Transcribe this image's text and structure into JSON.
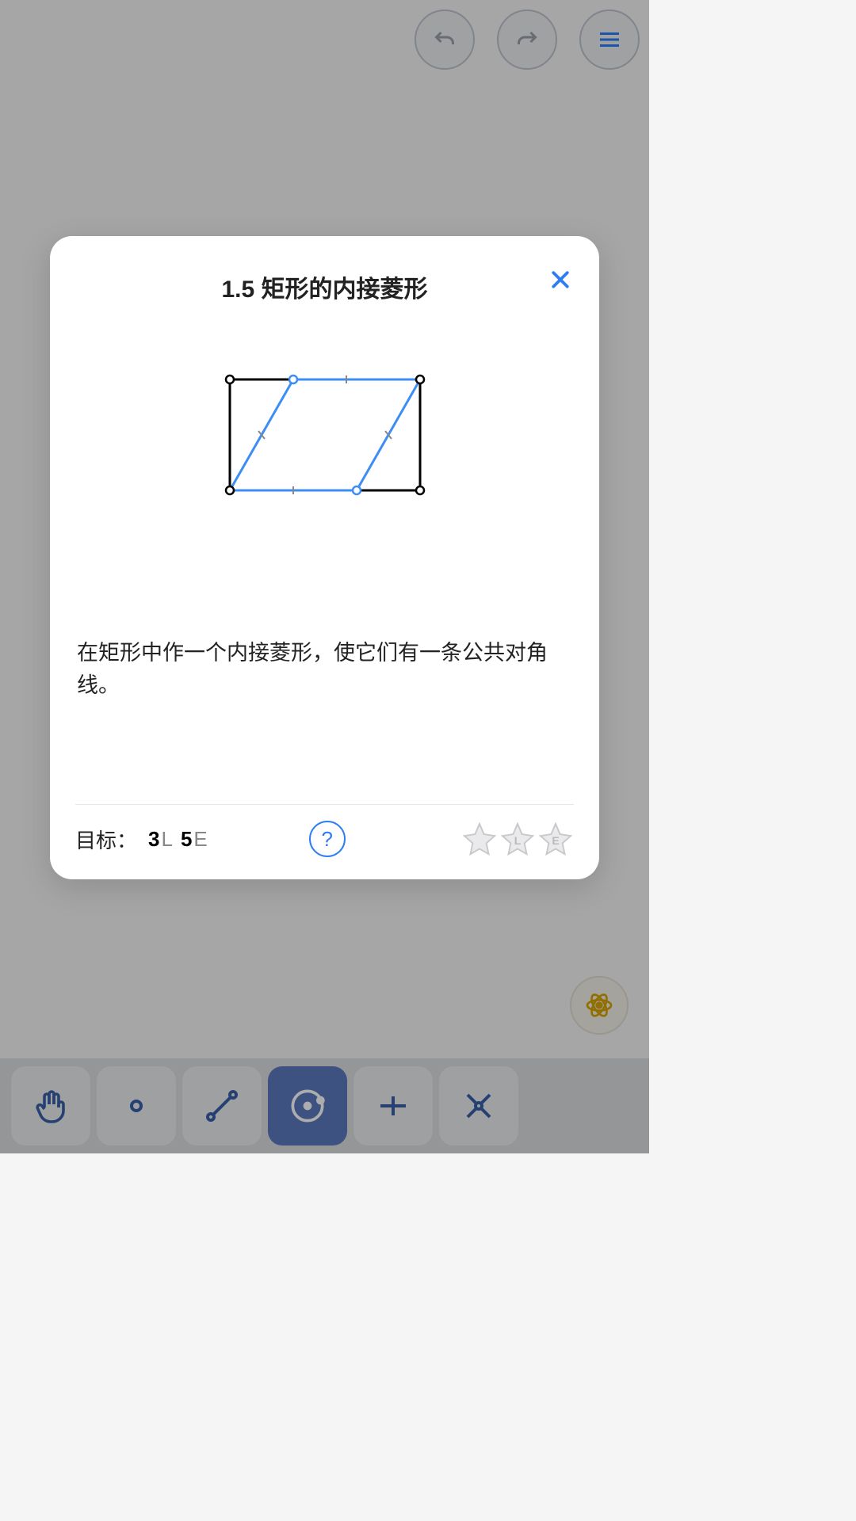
{
  "header": {
    "undo_icon": "undo-icon",
    "redo_icon": "redo-icon",
    "menu_icon": "menu-icon"
  },
  "modal": {
    "title": "1.5 矩形的内接菱形",
    "description": "在矩形中作一个内接菱形，使它们有一条公共对角线。",
    "goal_label": "目标：",
    "goals": [
      {
        "num": "3",
        "unit": "L"
      },
      {
        "num": "5",
        "unit": "E"
      }
    ],
    "help_label": "?",
    "stars": [
      {
        "letter": ""
      },
      {
        "letter": "L"
      },
      {
        "letter": "E"
      }
    ]
  },
  "toolbar": {
    "tools": [
      {
        "name": "hand-tool",
        "active": false
      },
      {
        "name": "point-tool",
        "active": false
      },
      {
        "name": "line-tool",
        "active": false
      },
      {
        "name": "circle-tool",
        "active": true
      },
      {
        "name": "perpendicular-tool",
        "active": false
      },
      {
        "name": "intersect-tool",
        "active": false
      }
    ]
  },
  "fab": {
    "icon": "atom-icon"
  }
}
